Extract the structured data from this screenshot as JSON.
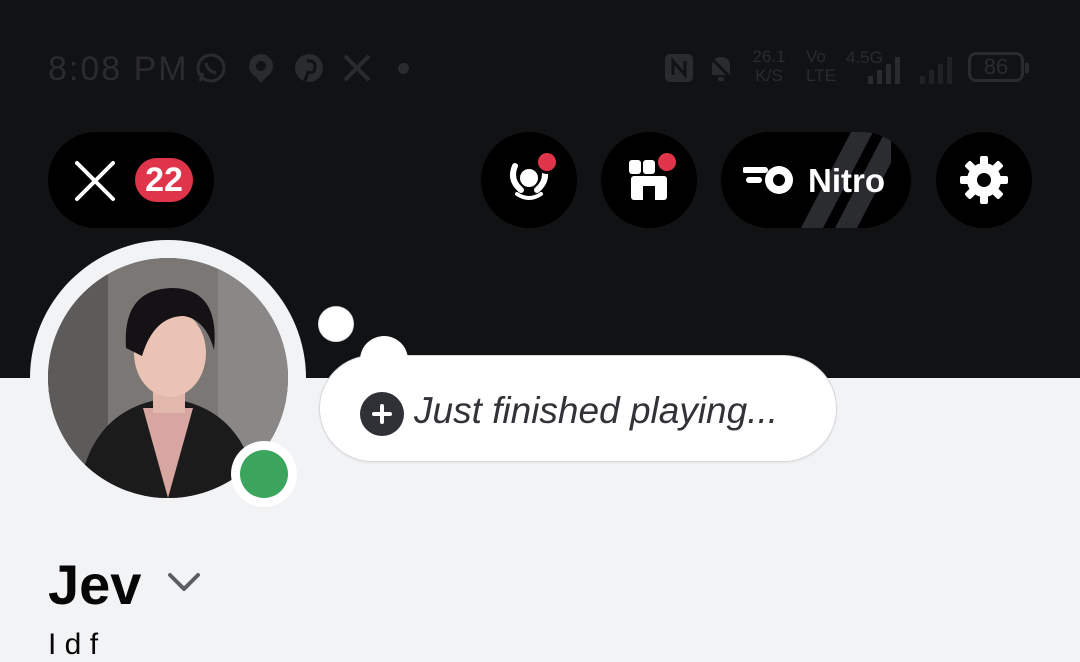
{
  "status_bar": {
    "time": "8:08 PM",
    "icons": [
      "whatsapp-icon",
      "location-icon",
      "pinterest-icon",
      "x-logo-icon",
      "nfc-icon",
      "bell-muted-icon",
      "signal-icon"
    ],
    "net_speed_value": "26.1",
    "net_speed_unit": "K/S",
    "volte_top": "Vo",
    "volte_bottom": "LTE",
    "network": "4.5G",
    "battery": "86"
  },
  "header": {
    "close_badge": "22",
    "nitro_label": "Nitro"
  },
  "profile": {
    "status_prompt": "Just finished playing...",
    "display_name": "Jev",
    "subtext": "I    d f"
  },
  "colors": {
    "banner": "#111214",
    "badge": "#e0344a",
    "online": "#3ba55d",
    "background": "#f2f3f5"
  }
}
